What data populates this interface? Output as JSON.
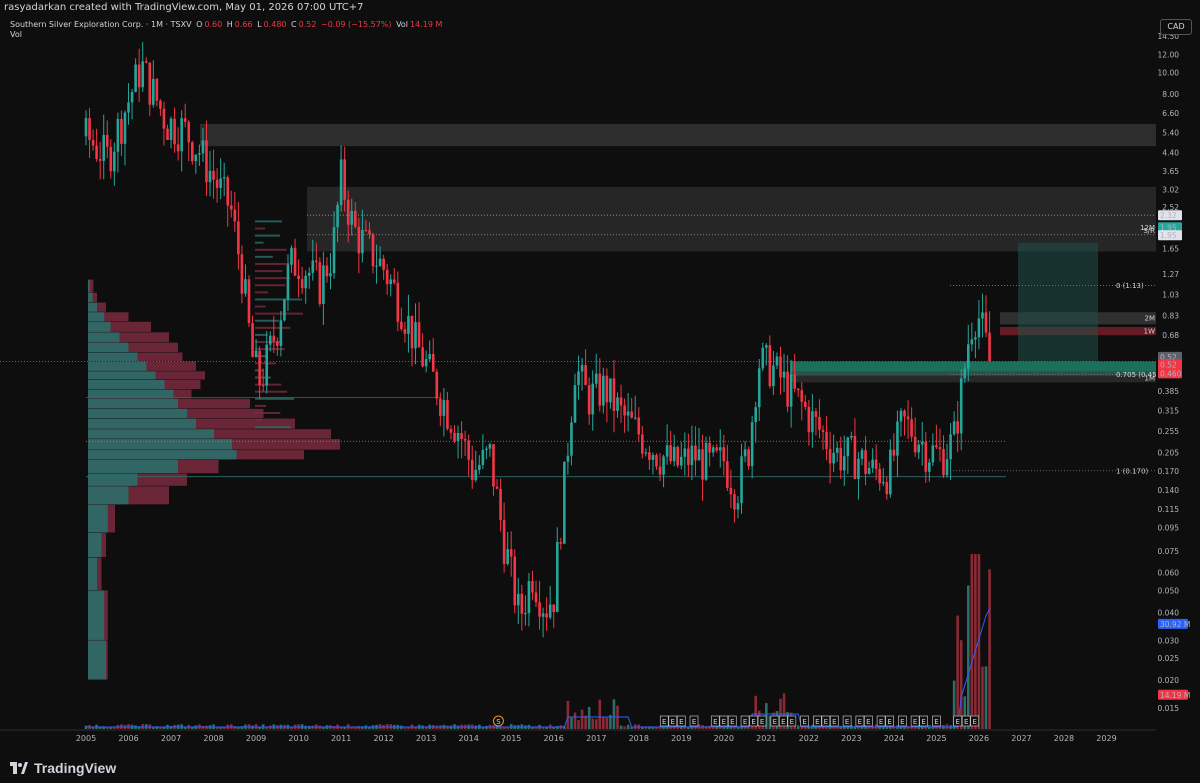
{
  "header": {
    "credit": "rasyadarkan created with TradingView.com, May 01, 2026 07:00 UTC+7",
    "symbol": "Southern Silver Exploration Corp. · 1M · TSXV",
    "open_label": "O",
    "open": "0.60",
    "high_label": "H",
    "high": "0.66",
    "low_label": "L",
    "low": "0.480",
    "close_label": "C",
    "close": "0.52",
    "change": "−0.09 (−15.57%)",
    "vol_label": "Vol",
    "vol_value": "14.19 M",
    "vol_pane_label": "Vol"
  },
  "currency_button": "CAD",
  "footer": {
    "brand": "TradingView"
  },
  "chart_data": {
    "type": "candlestick",
    "symbol": "Southern Silver Exploration Corp.",
    "interval": "1M",
    "exchange": "TSXV",
    "currency": "CAD",
    "y_scale": "log",
    "ylim": [
      0.012,
      14.5
    ],
    "y_ticks": [
      "14.50",
      "12.00",
      "10.00",
      "8.00",
      "6.60",
      "5.40",
      "4.40",
      "3.65",
      "3.02",
      "2.52",
      "1.65",
      "1.27",
      "1.03",
      "0.83",
      "0.68",
      "0.52",
      "0.385",
      "0.315",
      "0.255",
      "0.205",
      "0.170",
      "0.140",
      "0.115",
      "0.095",
      "0.075",
      "0.060",
      "0.050",
      "0.040",
      "0.030",
      "0.025",
      "0.020",
      "0.015"
    ],
    "x_ticks": [
      "2005",
      "2006",
      "2007",
      "2008",
      "2009",
      "2010",
      "2011",
      "2012",
      "2013",
      "2014",
      "2015",
      "2016",
      "2017",
      "2018",
      "2019",
      "2020",
      "2021",
      "2022",
      "2023",
      "2024",
      "2025",
      "2026",
      "2027",
      "2028",
      "2029"
    ],
    "xlim": [
      2005.0,
      2029.6
    ],
    "price_series": [
      [
        2005.0,
        5.2
      ],
      [
        2005.5,
        4.2
      ],
      [
        2006.0,
        7.5
      ],
      [
        2006.3,
        10.8
      ],
      [
        2006.6,
        8.0
      ],
      [
        2006.9,
        6.0
      ],
      [
        2007.3,
        5.6
      ],
      [
        2007.7,
        4.4
      ],
      [
        2008.0,
        3.4
      ],
      [
        2008.4,
        2.5
      ],
      [
        2008.7,
        1.2
      ],
      [
        2008.9,
        0.55
      ],
      [
        2009.1,
        0.42
      ],
      [
        2009.5,
        0.75
      ],
      [
        2009.8,
        1.4
      ],
      [
        2010.0,
        1.45
      ],
      [
        2010.5,
        1.15
      ],
      [
        2010.8,
        1.6
      ],
      [
        2011.0,
        3.4
      ],
      [
        2011.3,
        2.0
      ],
      [
        2011.7,
        1.6
      ],
      [
        2012.0,
        1.35
      ],
      [
        2012.4,
        0.95
      ],
      [
        2012.8,
        0.6
      ],
      [
        2013.1,
        0.46
      ],
      [
        2013.5,
        0.32
      ],
      [
        2013.8,
        0.25
      ],
      [
        2014.1,
        0.17
      ],
      [
        2014.5,
        0.2
      ],
      [
        2014.8,
        0.09
      ],
      [
        2015.2,
        0.038
      ],
      [
        2015.5,
        0.06
      ],
      [
        2015.8,
        0.042
      ],
      [
        2016.0,
        0.048
      ],
      [
        2016.2,
        0.12
      ],
      [
        2016.5,
        0.5
      ],
      [
        2016.8,
        0.36
      ],
      [
        2017.2,
        0.4
      ],
      [
        2017.6,
        0.3
      ],
      [
        2018.0,
        0.25
      ],
      [
        2018.5,
        0.2
      ],
      [
        2018.9,
        0.18
      ],
      [
        2019.3,
        0.2
      ],
      [
        2019.7,
        0.18
      ],
      [
        2020.0,
        0.19
      ],
      [
        2020.3,
        0.14
      ],
      [
        2020.6,
        0.22
      ],
      [
        2020.8,
        0.52
      ],
      [
        2021.1,
        0.5
      ],
      [
        2021.5,
        0.4
      ],
      [
        2021.9,
        0.32
      ],
      [
        2022.3,
        0.25
      ],
      [
        2022.7,
        0.2
      ],
      [
        2023.1,
        0.2
      ],
      [
        2023.5,
        0.17
      ],
      [
        2023.9,
        0.17
      ],
      [
        2024.2,
        0.28
      ],
      [
        2024.5,
        0.25
      ],
      [
        2024.8,
        0.21
      ],
      [
        2025.1,
        0.2
      ],
      [
        2025.4,
        0.23
      ],
      [
        2025.6,
        0.4
      ],
      [
        2025.8,
        0.75
      ],
      [
        2025.95,
        0.88
      ],
      [
        2026.1,
        0.7
      ],
      [
        2026.25,
        0.52
      ]
    ],
    "last_bar": {
      "open": 0.6,
      "high": 0.66,
      "low": 0.48,
      "close": 0.52,
      "change": -0.09,
      "change_pct": -15.57,
      "volume": "14.19 M"
    },
    "volume_ma": "30.92 M",
    "zones": [
      {
        "label": "2M",
        "range": [
          4.7,
          5.9
        ]
      },
      {
        "label": "",
        "range": [
          1.6,
          3.1
        ]
      },
      {
        "label": "2M",
        "range": [
          0.76,
          0.86
        ]
      },
      {
        "label": "1W",
        "range": [
          0.68,
          0.74
        ]
      },
      {
        "label": "1M",
        "range": [
          0.42,
          0.47
        ]
      }
    ],
    "fib_levels": [
      {
        "label": "0 (1.13)",
        "value": 1.13
      },
      {
        "label": "0.705 (0.455)",
        "value": 0.455
      },
      {
        "label": "1 (0.170)",
        "value": 0.17
      }
    ],
    "price_labels": [
      {
        "text": "2.32",
        "value": 2.32,
        "kind": "white"
      },
      {
        "text": "1.95",
        "value": 2.05,
        "kind": "green"
      },
      {
        "text": "1.95",
        "value": 1.89,
        "kind": "white"
      },
      {
        "text": "0.52",
        "value": 0.545,
        "kind": "grey"
      },
      {
        "text": "0.52",
        "value": 0.505,
        "kind": "red"
      },
      {
        "text": "0.460",
        "value": 0.46,
        "kind": "red"
      },
      {
        "text": "30.92 M",
        "value": 0.0355,
        "kind": "blue"
      },
      {
        "text": "14.19 M",
        "value": 0.0172,
        "kind": "red"
      }
    ],
    "line_tags": [
      {
        "text": "12M",
        "value": 2.05
      },
      {
        "text": "S/R",
        "value": 1.98
      },
      {
        "text": "2M",
        "value": 0.81
      },
      {
        "text": "1W",
        "value": 0.71
      },
      {
        "text": "1M",
        "value": 0.44
      }
    ],
    "earnings_marker_label": "E",
    "dividend_marker_label": "S"
  }
}
